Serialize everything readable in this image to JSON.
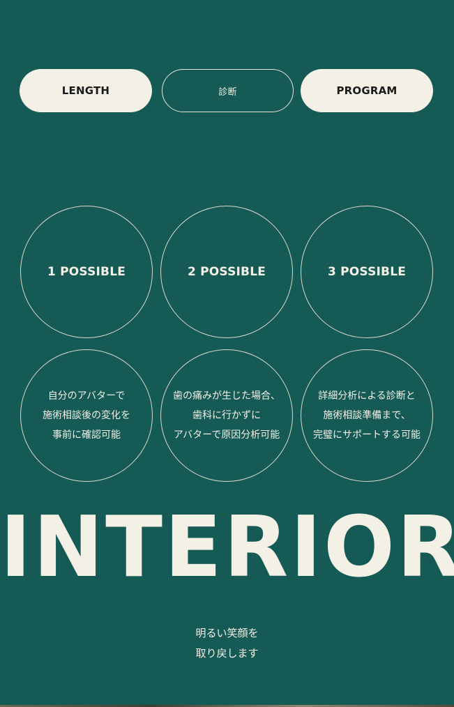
{
  "nav": {
    "buttons": [
      {
        "label": "LENGTH"
      },
      {
        "label": "診断"
      },
      {
        "label": "PROGRAM"
      }
    ]
  },
  "possibles": [
    {
      "title": "1 POSSIBLE",
      "desc": "自分のアバターで\n施術相談後の変化を\n事前に確認可能"
    },
    {
      "title": "2 POSSIBLE",
      "desc": "歯の痛みが生じた場合、\n歯科に行かずに\nアバターで原因分析可能"
    },
    {
      "title": "3 POSSIBLE",
      "desc": "詳細分析による診断と\n施術相談準備まで、\n完璧にサポートする可能"
    }
  ],
  "interior": {
    "title": "INTERIOR",
    "tagline": "明るい笑顔を\n取り戻します"
  },
  "colors": {
    "background": "#155a55",
    "cream": "#f3f0e6"
  }
}
